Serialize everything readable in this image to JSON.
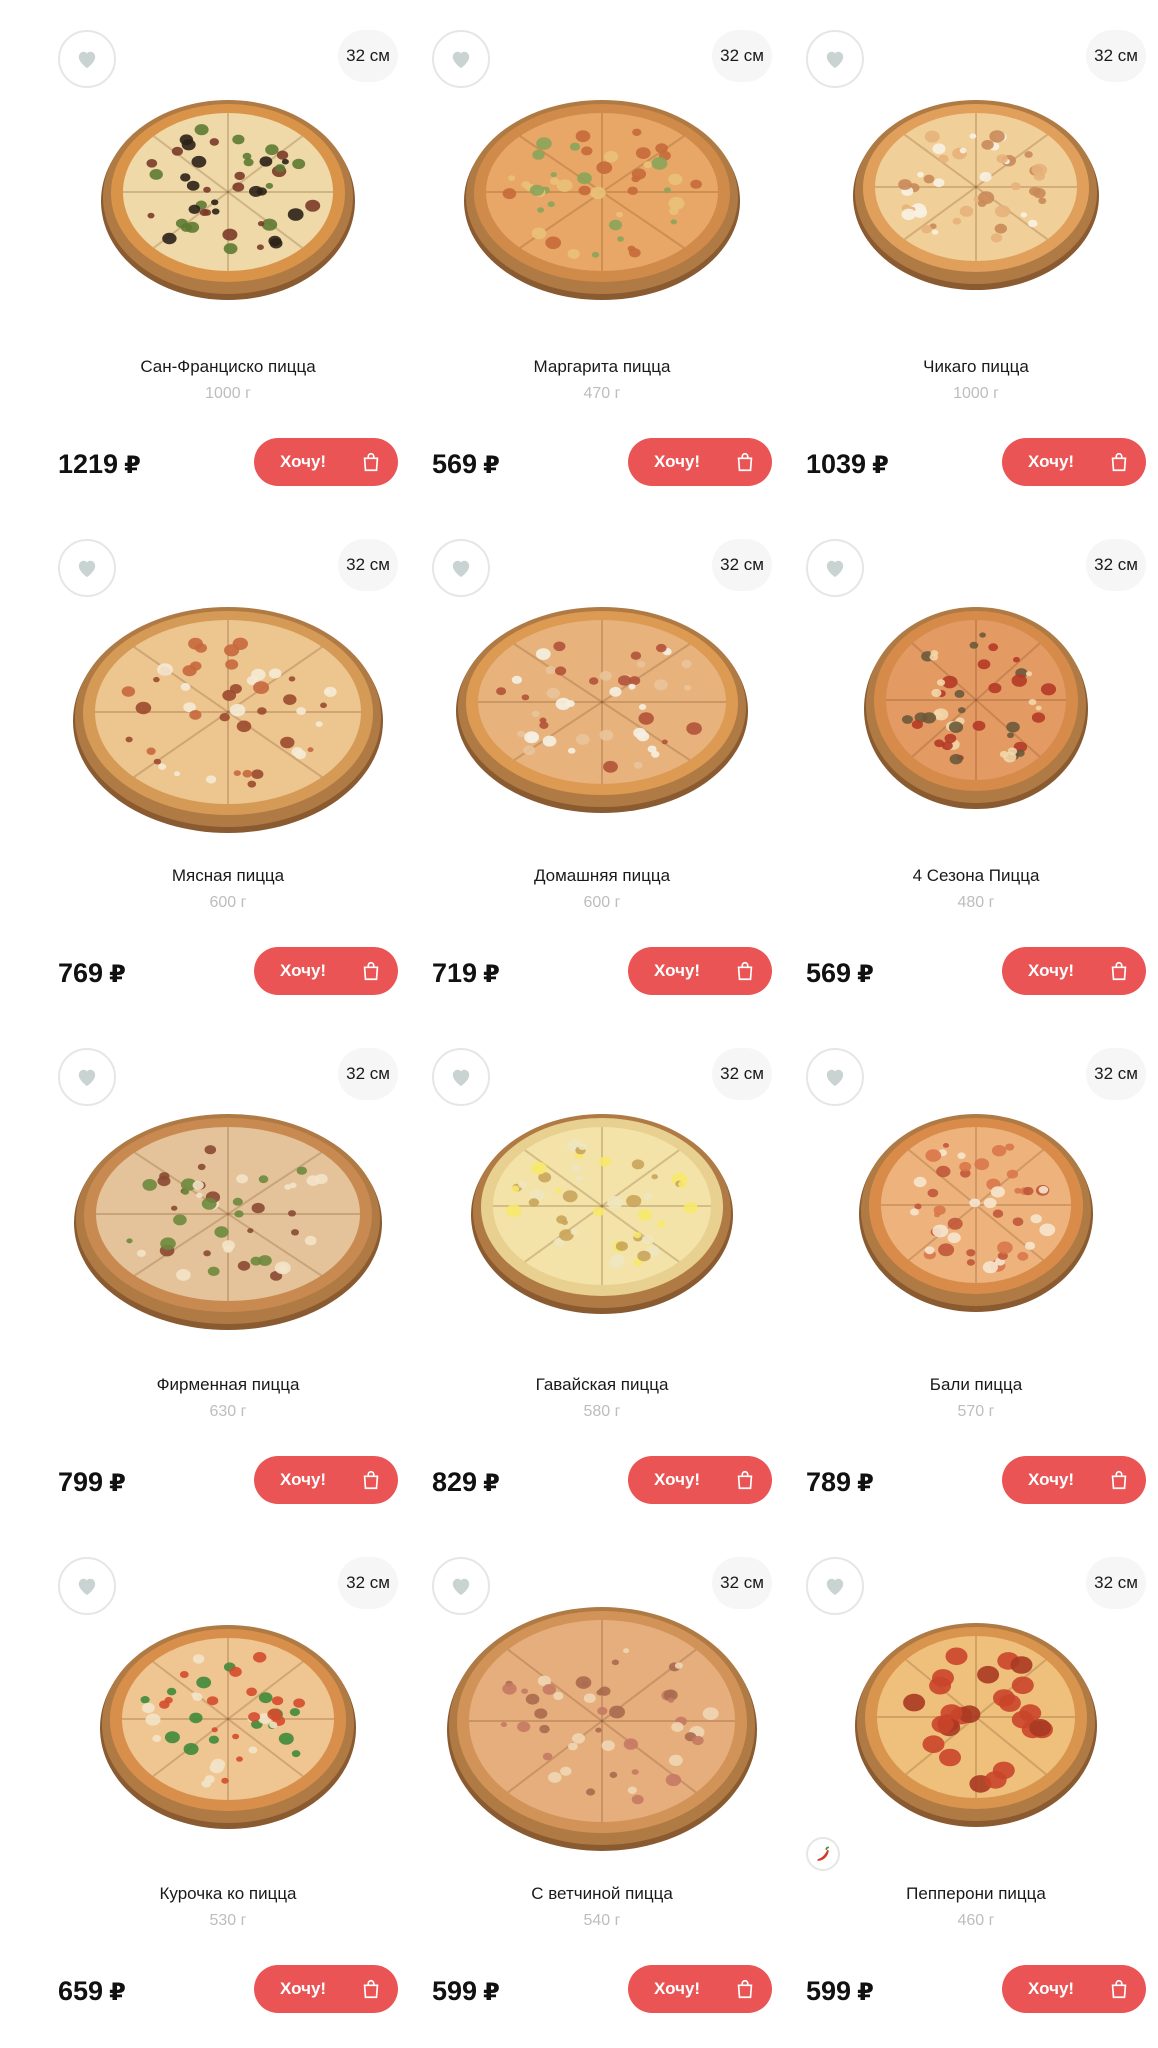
{
  "products": [
    {
      "name": "Сан-Франциско пицца",
      "weight": "1000 г",
      "price": "1219",
      "currency": "₽",
      "size": "32 см",
      "button": "Хочу!",
      "style": "sanfrancisco"
    },
    {
      "name": "Маргарита пицца",
      "weight": "470 г",
      "price": "569",
      "currency": "₽",
      "size": "32 см",
      "button": "Хочу!",
      "style": "margarita"
    },
    {
      "name": "Чикаго пицца",
      "weight": "1000 г",
      "price": "1039",
      "currency": "₽",
      "size": "32 см",
      "button": "Хочу!",
      "style": "chicago"
    },
    {
      "name": "Мясная пицца",
      "weight": "600 г",
      "price": "769",
      "currency": "₽",
      "size": "32 см",
      "button": "Хочу!",
      "style": "meat"
    },
    {
      "name": "Домашняя пицца",
      "weight": "600 г",
      "price": "719",
      "currency": "₽",
      "size": "32 см",
      "button": "Хочу!",
      "style": "home"
    },
    {
      "name": "4 Сезона Пицца",
      "weight": "480 г",
      "price": "569",
      "currency": "₽",
      "size": "32 см",
      "button": "Хочу!",
      "style": "seasons"
    },
    {
      "name": "Фирменная пицца",
      "weight": "630 г",
      "price": "799",
      "currency": "₽",
      "size": "32 см",
      "button": "Хочу!",
      "style": "signature"
    },
    {
      "name": "Гавайская пицца",
      "weight": "580 г",
      "price": "829",
      "currency": "₽",
      "size": "32 см",
      "button": "Хочу!",
      "style": "hawaii"
    },
    {
      "name": "Бали пицца",
      "weight": "570 г",
      "price": "789",
      "currency": "₽",
      "size": "32 см",
      "button": "Хочу!",
      "style": "bali"
    },
    {
      "name": "Курочка ко пицца",
      "weight": "530 г",
      "price": "659",
      "currency": "₽",
      "size": "32 см",
      "button": "Хочу!",
      "style": "chicken"
    },
    {
      "name": "С ветчиной пицца",
      "weight": "540 г",
      "price": "599",
      "currency": "₽",
      "size": "32 см",
      "button": "Хочу!",
      "style": "ham"
    },
    {
      "name": "Пепперони пицца",
      "weight": "460 г",
      "price": "599",
      "currency": "₽",
      "size": "32 см",
      "button": "Хочу!",
      "style": "pepperoni",
      "badge": "spicy-chili-icon"
    }
  ],
  "colors": {
    "accent": "#ea5455",
    "heart": "#c9d3d2",
    "weight_text": "#bdbdbd",
    "size_badge_bg": "#f6f6f6"
  }
}
